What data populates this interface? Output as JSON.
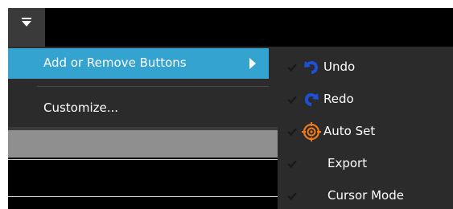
{
  "toolbar": {
    "qat_icon": "dropdown-triangle-icon"
  },
  "menu": {
    "items": [
      {
        "label": "Add or Remove Buttons",
        "has_submenu": true,
        "highlighted": true
      },
      {
        "label": "Customize..."
      }
    ],
    "highlight_color": "#35a3d0"
  },
  "submenu": {
    "items": [
      {
        "label": "Undo",
        "checked": true,
        "icon": "undo-icon"
      },
      {
        "label": "Redo",
        "checked": true,
        "icon": "redo-icon"
      },
      {
        "label": "Auto Set",
        "checked": true,
        "icon": "auto-set-icon"
      },
      {
        "label": "Export",
        "checked": true,
        "icon": ""
      },
      {
        "label": "Cursor Mode",
        "checked": true,
        "icon": ""
      }
    ]
  },
  "colors": {
    "menu_bg": "#2b2b2b",
    "icon_blue": "#1e4fd8",
    "icon_orange": "#f07a1a"
  }
}
